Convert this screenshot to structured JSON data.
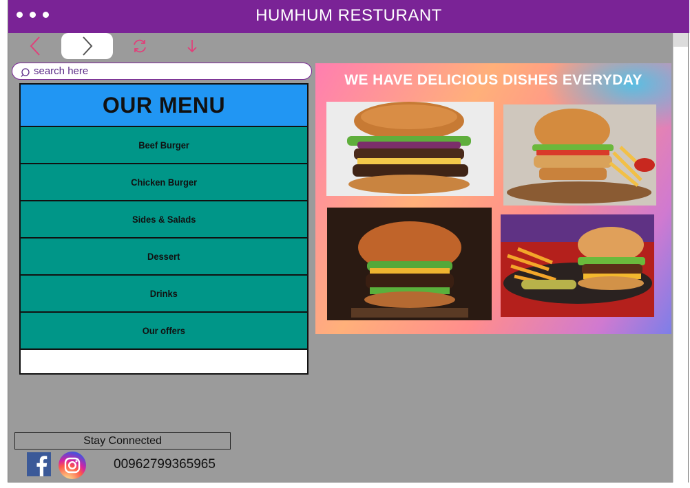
{
  "window": {
    "title": "HUMHUM RESTURANT"
  },
  "toolbar": {
    "back_icon": "chevron-left-icon",
    "forward_icon": "chevron-right-icon",
    "refresh_icon": "refresh-icon",
    "download_icon": "arrow-down-icon",
    "accent_color": "#e0407a"
  },
  "search": {
    "placeholder": "search here",
    "icon": "search-icon"
  },
  "menu": {
    "title": "OUR MENU",
    "items": [
      {
        "label": "Beef Burger"
      },
      {
        "label": "Chicken Burger"
      },
      {
        "label": "Sides & Salads"
      },
      {
        "label": "Dessert"
      },
      {
        "label": "Drinks"
      },
      {
        "label": "Our offers"
      }
    ]
  },
  "promo": {
    "heading": "WE HAVE DELICIOUS DISHES EVERYDAY",
    "images": [
      "double-cheeseburger",
      "chicken-burger-with-fries",
      "beef-burger-dark-background",
      "burger-with-fries-plate"
    ]
  },
  "footer": {
    "stay_connected": "Stay Connected",
    "phone": "00962799365965",
    "social": [
      "facebook-icon",
      "instagram-icon"
    ]
  },
  "colors": {
    "titlebar": "#7a2396",
    "menu_header": "#2196f3",
    "menu_item": "#009688",
    "window_bg": "#9b9b9b"
  }
}
